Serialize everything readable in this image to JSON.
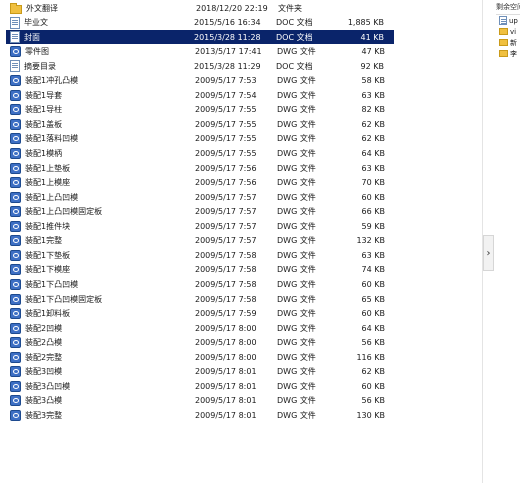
{
  "files": [
    {
      "name": "外文翻译",
      "date": "2018/12/20 22:19",
      "type": "文件夹",
      "size": "",
      "icon": "folder-icon",
      "selected": false
    },
    {
      "name": "毕业文",
      "date": "2015/5/16 16:34",
      "type": "DOC 文档",
      "size": "1,885 KB",
      "icon": "doc-file-icon",
      "selected": false
    },
    {
      "name": "封面",
      "date": "2015/3/28 11:28",
      "type": "DOC 文档",
      "size": "41 KB",
      "icon": "doc-file-icon",
      "selected": true
    },
    {
      "name": "零件图",
      "date": "2013/5/17 17:41",
      "type": "DWG 文件",
      "size": "47 KB",
      "icon": "dwg-file-icon",
      "selected": false
    },
    {
      "name": "摘要目录",
      "date": "2015/3/28 11:29",
      "type": "DOC 文档",
      "size": "92 KB",
      "icon": "doc-file-icon",
      "selected": false
    },
    {
      "name": "装配1冲孔凸模",
      "date": "2009/5/17 7:53",
      "type": "DWG 文件",
      "size": "58 KB",
      "icon": "dwg-file-icon",
      "selected": false
    },
    {
      "name": "装配1导套",
      "date": "2009/5/17 7:54",
      "type": "DWG 文件",
      "size": "63 KB",
      "icon": "dwg-file-icon",
      "selected": false
    },
    {
      "name": "装配1导柱",
      "date": "2009/5/17 7:55",
      "type": "DWG 文件",
      "size": "82 KB",
      "icon": "dwg-file-icon",
      "selected": false
    },
    {
      "name": "装配1盖板",
      "date": "2009/5/17 7:55",
      "type": "DWG 文件",
      "size": "62 KB",
      "icon": "dwg-file-icon",
      "selected": false
    },
    {
      "name": "装配1落料凹模",
      "date": "2009/5/17 7:55",
      "type": "DWG 文件",
      "size": "62 KB",
      "icon": "dwg-file-icon",
      "selected": false
    },
    {
      "name": "装配1模柄",
      "date": "2009/5/17 7:55",
      "type": "DWG 文件",
      "size": "64 KB",
      "icon": "dwg-file-icon",
      "selected": false
    },
    {
      "name": "装配1上垫板",
      "date": "2009/5/17 7:56",
      "type": "DWG 文件",
      "size": "63 KB",
      "icon": "dwg-file-icon",
      "selected": false
    },
    {
      "name": "装配1上模座",
      "date": "2009/5/17 7:56",
      "type": "DWG 文件",
      "size": "70 KB",
      "icon": "dwg-file-icon",
      "selected": false
    },
    {
      "name": "装配1上凸凹模",
      "date": "2009/5/17 7:57",
      "type": "DWG 文件",
      "size": "60 KB",
      "icon": "dwg-file-icon",
      "selected": false
    },
    {
      "name": "装配1上凸凹模固定板",
      "date": "2009/5/17 7:57",
      "type": "DWG 文件",
      "size": "66 KB",
      "icon": "dwg-file-icon",
      "selected": false
    },
    {
      "name": "装配1推件块",
      "date": "2009/5/17 7:57",
      "type": "DWG 文件",
      "size": "59 KB",
      "icon": "dwg-file-icon",
      "selected": false
    },
    {
      "name": "装配1完整",
      "date": "2009/5/17 7:57",
      "type": "DWG 文件",
      "size": "132 KB",
      "icon": "dwg-file-icon",
      "selected": false
    },
    {
      "name": "装配1下垫板",
      "date": "2009/5/17 7:58",
      "type": "DWG 文件",
      "size": "63 KB",
      "icon": "dwg-file-icon",
      "selected": false
    },
    {
      "name": "装配1下模座",
      "date": "2009/5/17 7:58",
      "type": "DWG 文件",
      "size": "74 KB",
      "icon": "dwg-file-icon",
      "selected": false
    },
    {
      "name": "装配1下凸凹模",
      "date": "2009/5/17 7:58",
      "type": "DWG 文件",
      "size": "60 KB",
      "icon": "dwg-file-icon",
      "selected": false
    },
    {
      "name": "装配1下凸凹模固定板",
      "date": "2009/5/17 7:58",
      "type": "DWG 文件",
      "size": "65 KB",
      "icon": "dwg-file-icon",
      "selected": false
    },
    {
      "name": "装配1卸料板",
      "date": "2009/5/17 7:59",
      "type": "DWG 文件",
      "size": "60 KB",
      "icon": "dwg-file-icon",
      "selected": false
    },
    {
      "name": "装配2凹模",
      "date": "2009/5/17 8:00",
      "type": "DWG 文件",
      "size": "64 KB",
      "icon": "dwg-file-icon",
      "selected": false
    },
    {
      "name": "装配2凸模",
      "date": "2009/5/17 8:00",
      "type": "DWG 文件",
      "size": "56 KB",
      "icon": "dwg-file-icon",
      "selected": false
    },
    {
      "name": "装配2完整",
      "date": "2009/5/17 8:00",
      "type": "DWG 文件",
      "size": "116 KB",
      "icon": "dwg-file-icon",
      "selected": false
    },
    {
      "name": "装配3凹模",
      "date": "2009/5/17 8:01",
      "type": "DWG 文件",
      "size": "62 KB",
      "icon": "dwg-file-icon",
      "selected": false
    },
    {
      "name": "装配3凸凹模",
      "date": "2009/5/17 8:01",
      "type": "DWG 文件",
      "size": "60 KB",
      "icon": "dwg-file-icon",
      "selected": false
    },
    {
      "name": "装配3凸模",
      "date": "2009/5/17 8:01",
      "type": "DWG 文件",
      "size": "56 KB",
      "icon": "dwg-file-icon",
      "selected": false
    },
    {
      "name": "装配3完整",
      "date": "2009/5/17 8:01",
      "type": "DWG 文件",
      "size": "130 KB",
      "icon": "dwg-file-icon",
      "selected": false
    }
  ],
  "side_panel": {
    "header": "剩余空间",
    "items": [
      {
        "label": "up",
        "icon": "file-icon"
      },
      {
        "label": "vi",
        "icon": "folder-icon"
      },
      {
        "label": "新",
        "icon": "folder-icon"
      },
      {
        "label": "李",
        "icon": "folder-icon"
      }
    ]
  },
  "expander": {
    "label": "›"
  },
  "colors": {
    "selection": "#0a246a",
    "folder": "#f0c040",
    "dwg": "#3d6fc4"
  }
}
